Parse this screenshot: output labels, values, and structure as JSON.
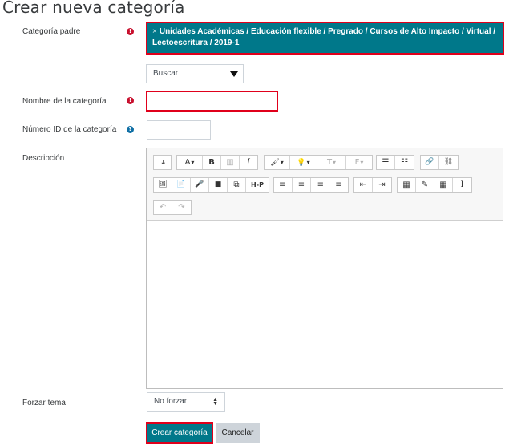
{
  "page": {
    "title": "Crear nueva categoría"
  },
  "form": {
    "parent": {
      "label": "Categoría padre",
      "remove_symbol": "×",
      "value_line1": "Unidades Académicas / Educación flexible / Pregrado / Cursos de Alto Impacto / Virtual /",
      "value_line2": "Lectoescritura / 2019-1",
      "search_label": "Buscar"
    },
    "name": {
      "label": "Nombre de la categoría",
      "value": ""
    },
    "idnumber": {
      "label": "Número ID de la categoría",
      "value": ""
    },
    "description": {
      "label": "Descripción"
    },
    "theme": {
      "label": "Forzar tema",
      "selected": "No forzar"
    },
    "required_symbol": "!",
    "help_symbol": "?"
  },
  "buttons": {
    "submit": "Crear categoría",
    "cancel": "Cancelar"
  },
  "toolbar": {
    "toggle": "↴",
    "font": "A",
    "bold": "B",
    "table_layout": "▥",
    "italic": "I",
    "brush": "🖌",
    "bulb": "💡",
    "text_format": "T",
    "font_family": "F",
    "ul": "☰",
    "ol": "☷",
    "link": "🔗",
    "unlink": "⛓",
    "image": "🖼",
    "file": "📄",
    "mic": "🎤",
    "video": "■",
    "copy": "⧉",
    "h5p": "H-P",
    "align_left": "≡",
    "align_center": "≡",
    "align_right": "≡",
    "justify": "≡",
    "outdent": "⇤",
    "indent": "⇥",
    "calculator": "▦",
    "edit": "✎",
    "table": "▦",
    "cursor": "I",
    "undo": "↶",
    "redo": "↷"
  },
  "colors": {
    "primary": "#00788a",
    "highlight_border": "#e0001b",
    "required": "#c8102e",
    "help": "#0f6fa5",
    "secondary": "#ced4da"
  }
}
